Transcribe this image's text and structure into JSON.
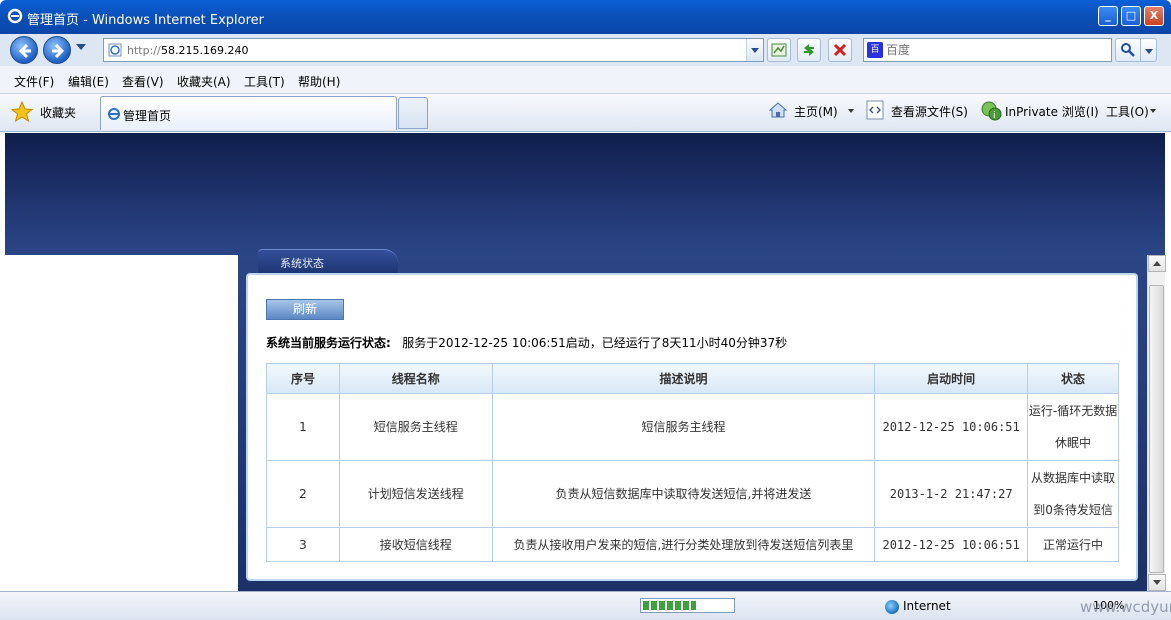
{
  "window": {
    "title": "管理首页 - Windows Internet Explorer",
    "buttons": [
      "_",
      "□",
      "X"
    ]
  },
  "address_bar": {
    "url_proto": "http://",
    "url_host": "58.215.169.240",
    "url_tail": "/"
  },
  "search": {
    "placeholder": "百度"
  },
  "menu": [
    "文件(F)",
    "编辑(E)",
    "查看(V)",
    "收藏夹(A)",
    "工具(T)",
    "帮助(H)"
  ],
  "favorites": {
    "label": "收藏夹",
    "tab_label": "管理首页"
  },
  "command_bar": {
    "home": "主页(M)",
    "view_source": "查看源文件(S)",
    "inprivate": "InPrivate 浏览(I)",
    "tools": "工具(O)"
  },
  "page": {
    "section_tab": "系统状态",
    "refresh_label": "刷新",
    "status_label": "系统当前服务运行状态:",
    "status_text": "服务于2012-12-25 10:06:51启动，已经运行了8天11小时40分钟37秒",
    "table": {
      "headers": [
        "序号",
        "线程名称",
        "描述说明",
        "启动时间",
        "状态"
      ],
      "rows": [
        [
          "1",
          "短信服务主线程",
          "短信服务主线程",
          "2012-12-25 10:06:51",
          "运行-循环无数据休眠中"
        ],
        [
          "2",
          "计划短信发送线程",
          "负责从短信数据库中读取待发送短信,并将进发送",
          "2013-1-2 21:47:27",
          "从数据库中读取到0条待发短信"
        ],
        [
          "3",
          "接收短信线程",
          "负责从接收用户发来的短信,进行分类处理放到待发送短信列表里",
          "2012-12-25 10:06:51",
          "正常运行中"
        ]
      ]
    }
  },
  "status_bar": {
    "zone": "Internet",
    "zoom": "100%",
    "progress": 0.6
  },
  "watermark": "www.wcdyun.org"
}
